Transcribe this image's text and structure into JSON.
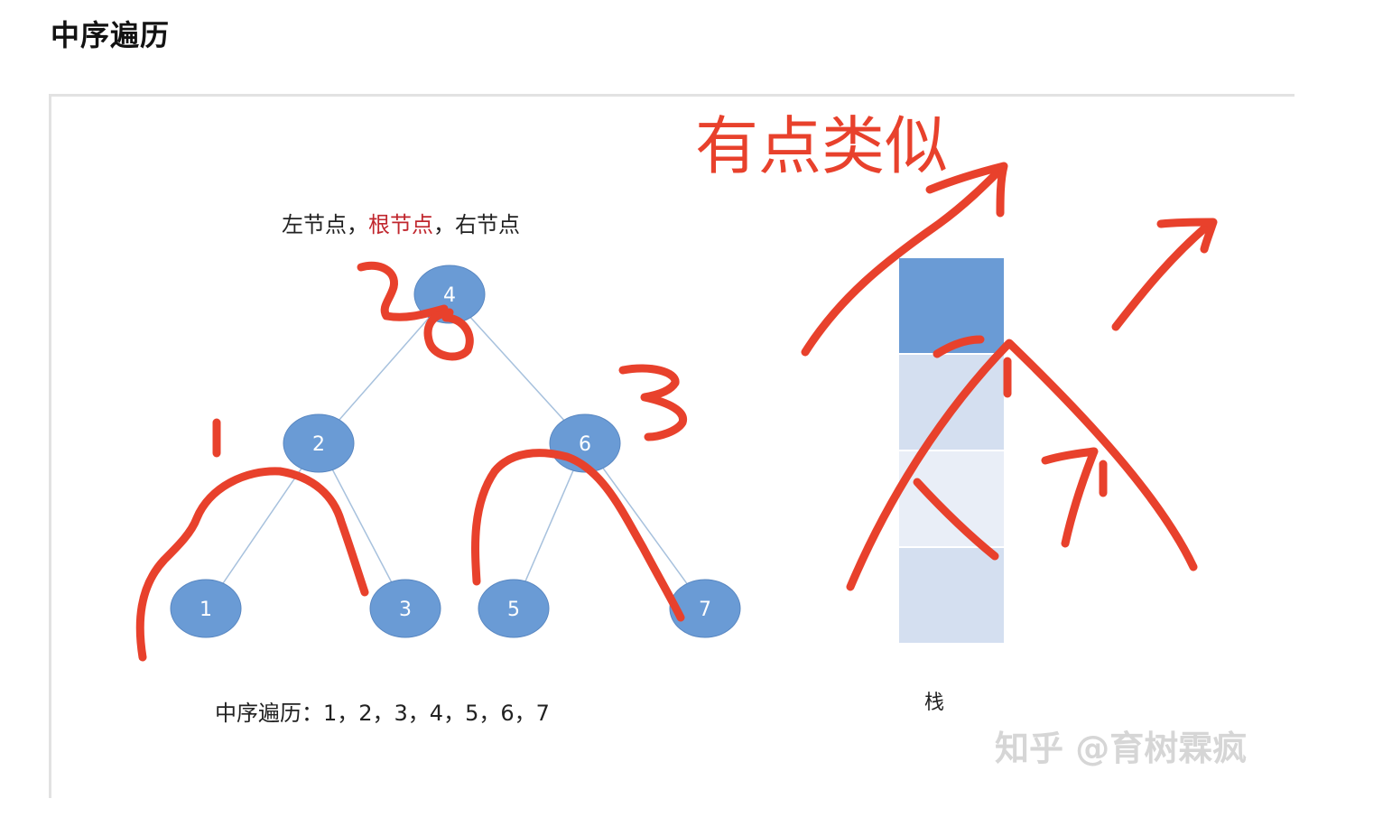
{
  "heading": "中序遍历",
  "caption_top": {
    "left": "左节点，",
    "root": "根节点",
    "right": "，右节点",
    "root_color": "#c0262d"
  },
  "tree": {
    "node_color": "#6a9bd5",
    "edge_color": "#a7c1dd",
    "nodes": [
      {
        "id": "4",
        "label": "4"
      },
      {
        "id": "2",
        "label": "2"
      },
      {
        "id": "6",
        "label": "6"
      },
      {
        "id": "1",
        "label": "1"
      },
      {
        "id": "3",
        "label": "3"
      },
      {
        "id": "5",
        "label": "5"
      },
      {
        "id": "7",
        "label": "7"
      }
    ],
    "edges": [
      [
        "4",
        "2"
      ],
      [
        "4",
        "6"
      ],
      [
        "2",
        "1"
      ],
      [
        "2",
        "3"
      ],
      [
        "6",
        "5"
      ],
      [
        "6",
        "7"
      ]
    ]
  },
  "caption_bottom": {
    "prefix": "中序遍历：",
    "sequence": "1，2，3，4，5，6，7"
  },
  "stack": {
    "label": "栈",
    "cells": [
      {
        "color": "#6a9bd5"
      },
      {
        "color": "#d4dff0"
      },
      {
        "color": "#e9eef7"
      },
      {
        "color": "#d4dff0"
      }
    ]
  },
  "annotations": {
    "note": "有点类似",
    "ink_color": "#e8412c"
  },
  "watermark": "知乎 @育树霖疯"
}
